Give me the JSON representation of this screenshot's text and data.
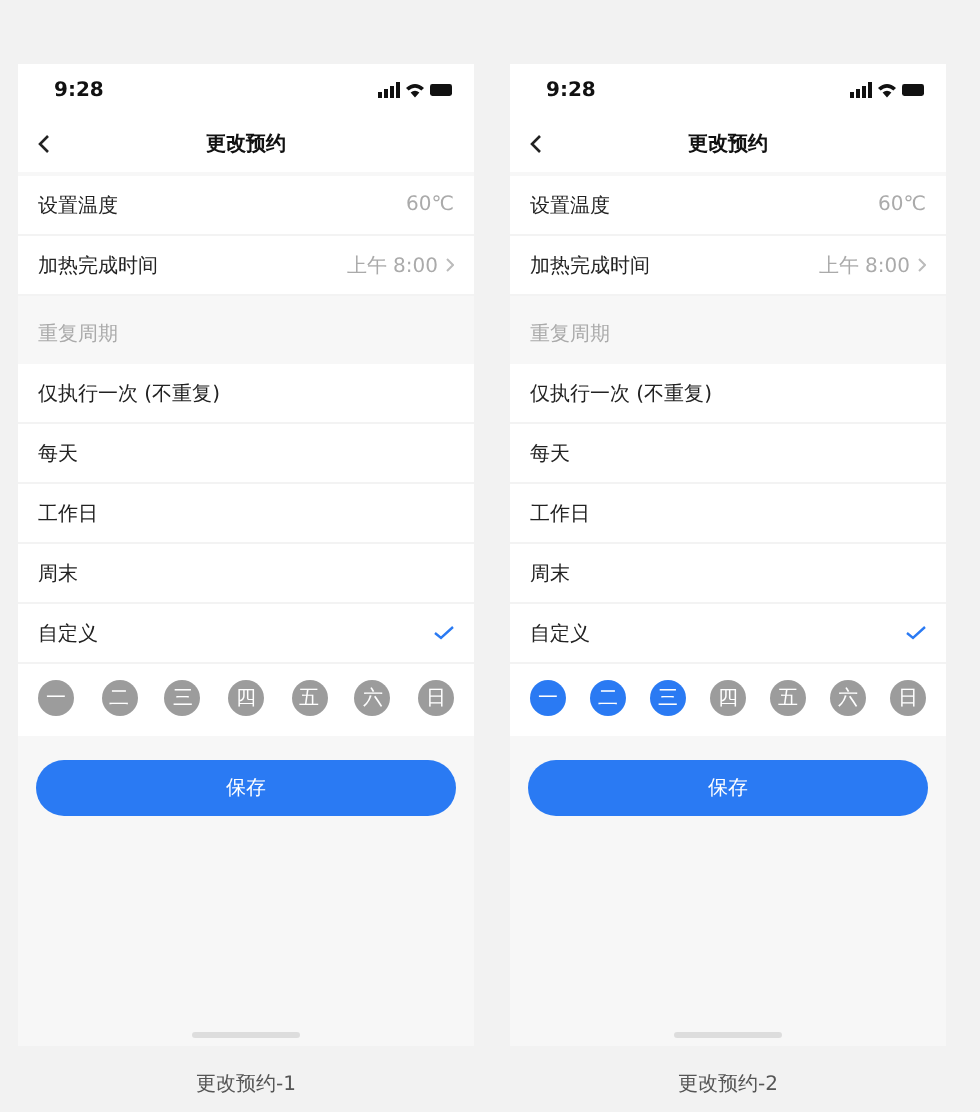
{
  "screens": [
    {
      "status_time": "9:28",
      "title": "更改预约",
      "rows": [
        {
          "label": "设置温度",
          "value": "60℃",
          "chevron": false
        },
        {
          "label": "加热完成时间",
          "value": "上午 8:00",
          "chevron": true
        }
      ],
      "section_header": "重复周期",
      "options": [
        {
          "label": "仅执行一次 (不重复)",
          "selected": false
        },
        {
          "label": "每天",
          "selected": false
        },
        {
          "label": "工作日",
          "selected": false
        },
        {
          "label": "周末",
          "selected": false
        },
        {
          "label": "自定义",
          "selected": true
        }
      ],
      "days": [
        {
          "label": "一",
          "selected": false
        },
        {
          "label": "二",
          "selected": false
        },
        {
          "label": "三",
          "selected": false
        },
        {
          "label": "四",
          "selected": false
        },
        {
          "label": "五",
          "selected": false
        },
        {
          "label": "六",
          "selected": false
        },
        {
          "label": "日",
          "selected": false
        }
      ],
      "save": "保存",
      "caption": "更改预约-1"
    },
    {
      "status_time": "9:28",
      "title": "更改预约",
      "rows": [
        {
          "label": "设置温度",
          "value": "60℃",
          "chevron": false
        },
        {
          "label": "加热完成时间",
          "value": "上午 8:00",
          "chevron": true
        }
      ],
      "section_header": "重复周期",
      "options": [
        {
          "label": "仅执行一次 (不重复)",
          "selected": false
        },
        {
          "label": "每天",
          "selected": false
        },
        {
          "label": "工作日",
          "selected": false
        },
        {
          "label": "周末",
          "selected": false
        },
        {
          "label": "自定义",
          "selected": true
        }
      ],
      "days": [
        {
          "label": "一",
          "selected": true
        },
        {
          "label": "二",
          "selected": true
        },
        {
          "label": "三",
          "selected": true
        },
        {
          "label": "四",
          "selected": false
        },
        {
          "label": "五",
          "selected": false
        },
        {
          "label": "六",
          "selected": false
        },
        {
          "label": "日",
          "selected": false
        }
      ],
      "save": "保存",
      "caption": "更改预约-2"
    }
  ]
}
